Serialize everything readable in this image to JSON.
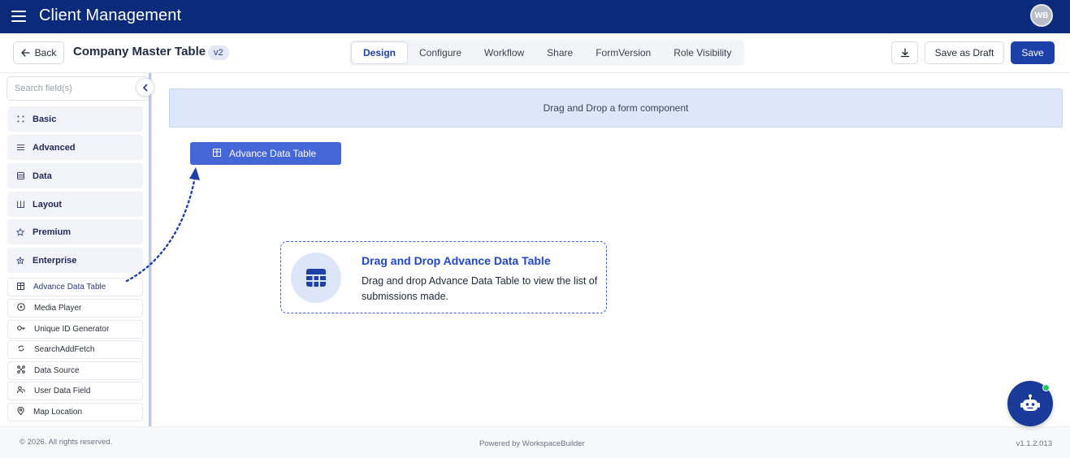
{
  "app": {
    "title": "Client Management",
    "avatar_initials": "WB"
  },
  "toolbar": {
    "back_label": "Back",
    "page_title": "Company Master Table",
    "version": "v2",
    "tabs": [
      "Design",
      "Configure",
      "Workflow",
      "Share",
      "FormVersion",
      "Role Visibility"
    ],
    "active_tab": "Design",
    "save_draft_label": "Save as Draft",
    "save_label": "Save"
  },
  "sidebar": {
    "search_placeholder": "Search field(s)",
    "categories": [
      "Basic",
      "Advanced",
      "Data",
      "Layout",
      "Premium",
      "Enterprise"
    ],
    "fields": [
      "Advance Data Table",
      "Media Player",
      "Unique ID Generator",
      "SearchAddFetch",
      "Data Source",
      "User Data Field",
      "Map Location"
    ]
  },
  "canvas": {
    "dropzone_text": "Drag and Drop a form component",
    "dragged_component": "Advance Data Table",
    "hint_title": "Drag and Drop Advance Data Table",
    "hint_description": "Drag and drop Advance Data Table to view the list of submissions made."
  },
  "footer": {
    "copyright": "© 2026. All rights reserved.",
    "powered_by": "Powered by WorkspaceBuilder",
    "version": "v1.1.2.013"
  },
  "colors": {
    "brand": "#0b2a7a",
    "primary": "#1d3fa8",
    "accent": "#4566d6",
    "status_online": "#22c55e"
  },
  "icons": {
    "menu": "hamburger-icon",
    "back": "arrow-left-icon",
    "download": "download-icon",
    "collapse": "chevron-left-icon",
    "table": "table-icon",
    "bot": "bot-icon"
  }
}
